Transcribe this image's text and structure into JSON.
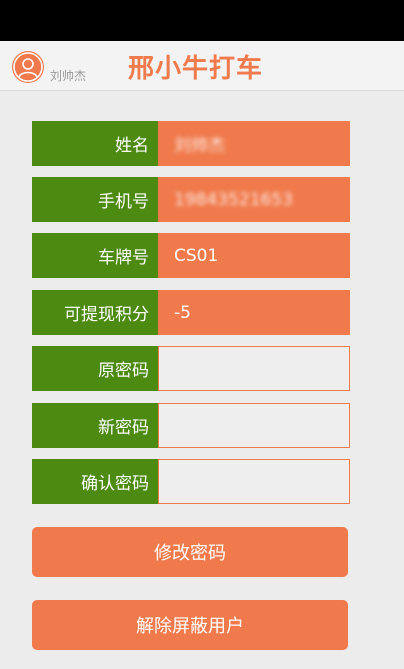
{
  "header": {
    "user_name": "刘帅杰",
    "title": "邢小牛打车"
  },
  "fields": {
    "name": {
      "label": "姓名",
      "value": "刘帅杰"
    },
    "phone": {
      "label": "手机号",
      "value": "19843521653"
    },
    "plate": {
      "label": "车牌号",
      "value": "CS01"
    },
    "points": {
      "label": "可提现积分",
      "value": "-5"
    },
    "old_password": {
      "label": "原密码",
      "value": ""
    },
    "new_password": {
      "label": "新密码",
      "value": ""
    },
    "confirm_password": {
      "label": "确认密码",
      "value": ""
    }
  },
  "buttons": {
    "change_password": "修改密码",
    "unblock_user": "解除屏蔽用户"
  },
  "colors": {
    "accent": "#f07a4c",
    "label_green": "#4d8a12",
    "background": "#ececec"
  },
  "icons": {
    "avatar": "user-avatar-icon"
  }
}
